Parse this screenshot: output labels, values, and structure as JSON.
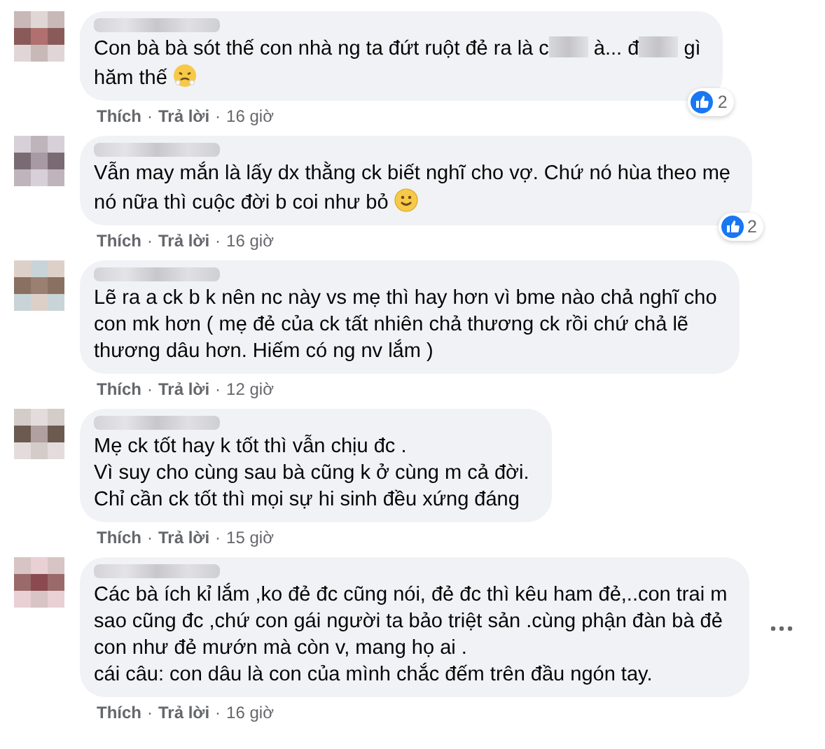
{
  "comments": [
    {
      "segments": [
        {
          "kind": "text",
          "text": "Con bà bà sót thế con nhà ng ta đứt ruột đẻ ra là c"
        },
        {
          "kind": "redacted"
        },
        {
          "kind": "text",
          "text": " à... đ"
        },
        {
          "kind": "redacted"
        },
        {
          "kind": "text",
          "text": " gì"
        },
        {
          "kind": "break"
        },
        {
          "kind": "text",
          "text": "hăm thế "
        },
        {
          "kind": "emoji"
        }
      ],
      "actions": [
        "Thích",
        "·",
        "Trả lời",
        "·",
        "16 giờ"
      ],
      "likes": "2",
      "menu": false
    },
    {
      "segments": [
        {
          "kind": "text",
          "text": "Vẫn may mắn là lấy dx thằng ck biết nghĩ cho vợ. Chứ nó hùa theo mẹ"
        },
        {
          "kind": "break"
        },
        {
          "kind": "text",
          "text": "nó nữa thì cuộc đời b coi như bỏ "
        },
        {
          "kind": "emoji"
        }
      ],
      "actions": [
        "Thích",
        "·",
        "Trả lời",
        "·",
        "16 giờ"
      ],
      "likes": "2",
      "menu": false
    },
    {
      "segments": [
        {
          "kind": "text",
          "text": "Lẽ ra a ck b k nên nc này vs mẹ thì hay hơn vì bme nào chả nghĩ cho"
        },
        {
          "kind": "break"
        },
        {
          "kind": "text",
          "text": "con mk hơn ( mẹ đẻ của ck tất nhiên chả thương ck rồi chứ chả lẽ"
        },
        {
          "kind": "break"
        },
        {
          "kind": "text",
          "text": "thương dâu hơn. Hiếm có ng nv lắm )"
        }
      ],
      "actions": [
        "Thích",
        "·",
        "Trả lời",
        "·",
        "12 giờ"
      ],
      "menu": false
    },
    {
      "segments": [
        {
          "kind": "text",
          "text": "Mẹ ck tốt hay k tốt thì vẫn chịu đc ."
        },
        {
          "kind": "break"
        },
        {
          "kind": "text",
          "text": "Vì suy cho cùng sau bà cũng k ở cùng m cả đời."
        },
        {
          "kind": "break"
        },
        {
          "kind": "text",
          "text": "Chỉ cần ck tốt thì mọi sự hi sinh đều xứng đáng"
        }
      ],
      "actions": [
        "Thích",
        "·",
        "Trả lời",
        "·",
        "15 giờ"
      ],
      "menu": false
    },
    {
      "segments": [
        {
          "kind": "text",
          "text": "Các bà ích kỉ lắm ,ko đẻ đc cũng nói, đẻ đc thì kêu ham đẻ,..con trai m"
        },
        {
          "kind": "break"
        },
        {
          "kind": "text",
          "text": "sao cũng đc ,chứ con gái người ta bảo triệt sản .cùng phận đàn bà đẻ"
        },
        {
          "kind": "break"
        },
        {
          "kind": "text",
          "text": "con như đẻ mướn mà còn v, mang họ ai ."
        },
        {
          "kind": "break"
        },
        {
          "kind": "text",
          "text": "cái câu: con dâu là con của mình chắc đếm trên đầu ngón tay."
        }
      ],
      "actions": [
        "Thích",
        "·",
        "Trả lời",
        "·",
        "16 giờ"
      ],
      "menu": true
    }
  ]
}
